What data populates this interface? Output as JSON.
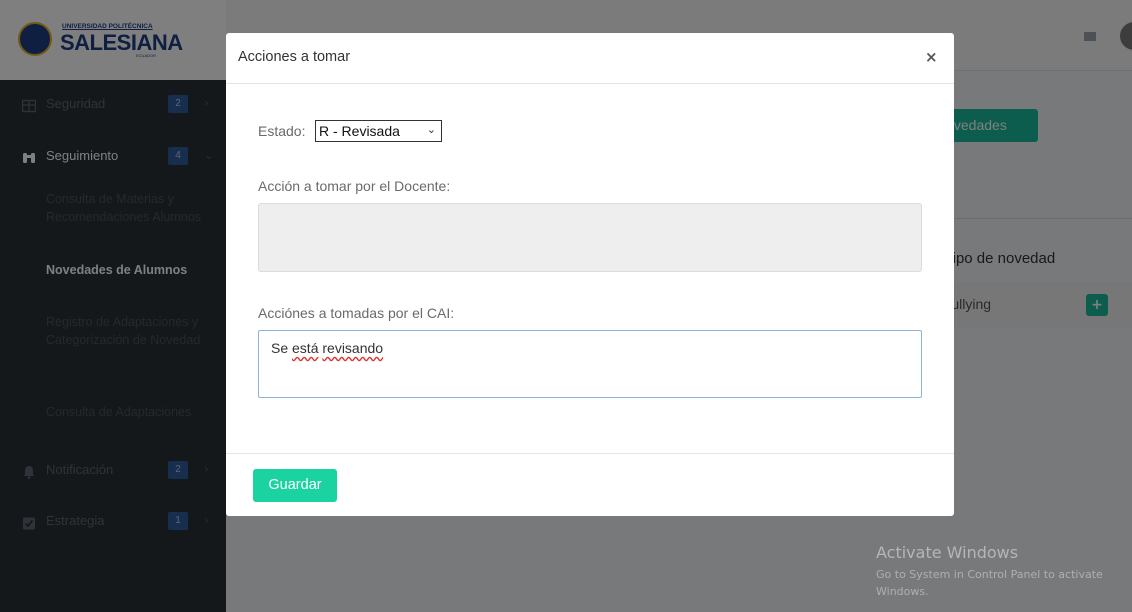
{
  "logo": {
    "small": "UNIVERSIDAD POLITÉCNICA",
    "big": "SALESIANA",
    "country": "ECUADOR"
  },
  "sidebar": {
    "items": [
      {
        "label": "Seguridad",
        "badge": "2",
        "icon": "grid-icon"
      },
      {
        "label": "Seguimiento",
        "badge": "4",
        "icon": "binoculars-icon"
      },
      {
        "label": "Notificación",
        "badge": "2",
        "icon": "bell-icon"
      },
      {
        "label": "Estrategia",
        "badge": "1",
        "icon": "clipboard-check-icon"
      }
    ],
    "sub_items": [
      "Consulta de Materias y Recomendaciones Alumnos",
      "Novedades de Alumnos",
      "Registro de Adaptaciones y Categorización de Novedad",
      "Consulta de Adaptaciones"
    ]
  },
  "background": {
    "button_label": "Novedades",
    "column_header": "Tipo de novedad",
    "row_value": "Bullying",
    "row_action": "+"
  },
  "modal": {
    "title": "Acciones a tomar",
    "close": "×",
    "estado_label": "Estado:",
    "estado_value": "R - Revisada",
    "docente_label": "Acción a tomar por el Docente:",
    "docente_value": "",
    "cai_label": "Acciónes a tomadas por el CAI:",
    "cai_value_prefix": "Se ",
    "cai_value_w1": "está",
    "cai_value_sep": " ",
    "cai_value_w2": "revisando",
    "save_label": "Guardar"
  },
  "watermark": {
    "title": "Activate Windows",
    "subtitle": "Go to System in Control Panel to activate Windows."
  },
  "colors": {
    "sidebar": "#2b3036",
    "accent": "#1bd3a0",
    "badge": "#2f5d9c"
  }
}
